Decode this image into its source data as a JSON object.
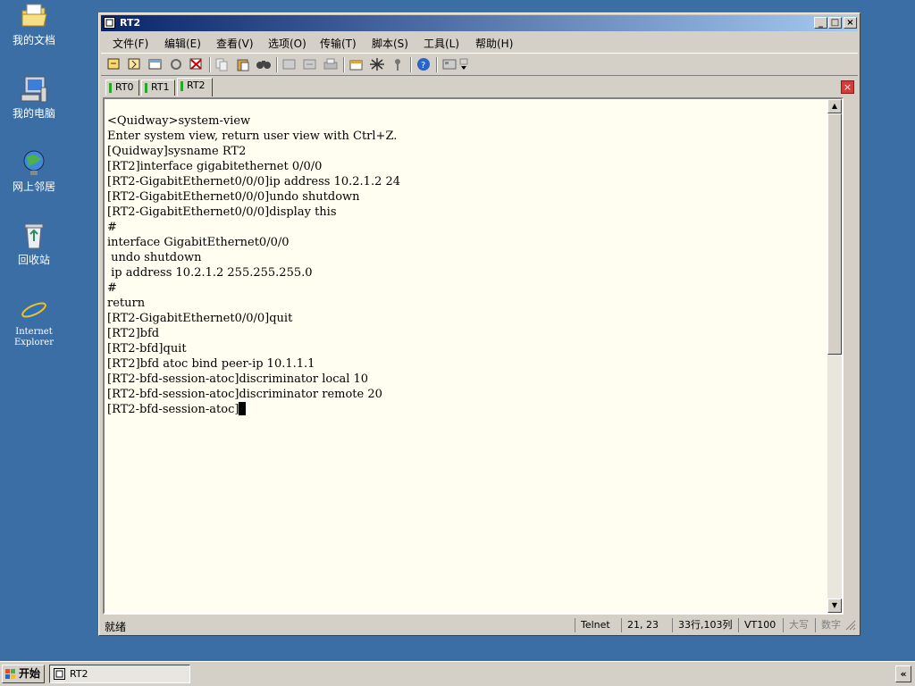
{
  "desktop": {
    "icons": [
      {
        "label": "我的文档",
        "icon": "folder-documents-icon"
      },
      {
        "label": "我的电脑",
        "icon": "computer-icon"
      },
      {
        "label": "网上邻居",
        "icon": "network-icon"
      },
      {
        "label": "回收站",
        "icon": "recycle-bin-icon"
      },
      {
        "label": "Internet Explorer",
        "label_line1": "Internet",
        "label_line2": "Explorer",
        "icon": "ie-icon"
      }
    ]
  },
  "window": {
    "title": "RT2",
    "menu": [
      "文件(F)",
      "编辑(E)",
      "查看(V)",
      "选项(O)",
      "传输(T)",
      "脚本(S)",
      "工具(L)",
      "帮助(H)"
    ],
    "tabs": [
      {
        "label": "RT0",
        "active": false
      },
      {
        "label": "RT1",
        "active": false
      },
      {
        "label": "RT2",
        "active": true
      }
    ],
    "close_tab_label": "×",
    "terminal_lines": [
      "<Quidway>system-view",
      "Enter system view, return user view with Ctrl+Z.",
      "[Quidway]sysname RT2",
      "[RT2]interface gigabitethernet 0/0/0",
      "[RT2-GigabitEthernet0/0/0]ip address 10.2.1.2 24",
      "[RT2-GigabitEthernet0/0/0]undo shutdown",
      "[RT2-GigabitEthernet0/0/0]display this",
      "#",
      "interface GigabitEthernet0/0/0",
      " undo shutdown",
      " ip address 10.2.1.2 255.255.255.0",
      "#",
      "return",
      "[RT2-GigabitEthernet0/0/0]quit",
      "[RT2]bfd",
      "[RT2-bfd]quit",
      "[RT2]bfd atoc bind peer-ip 10.1.1.1",
      "[RT2-bfd-session-atoc]discriminator local 10",
      "[RT2-bfd-session-atoc]discriminator remote 20",
      "[RT2-bfd-session-atoc]"
    ],
    "status": {
      "ready": "就绪",
      "protocol": "Telnet",
      "cursor_pos": "21,  23",
      "size": "33行,103列",
      "terminal_type": "VT100",
      "caps": "大写",
      "num": "数字"
    }
  },
  "taskbar": {
    "start_label": "开始",
    "task_label": "RT2",
    "tray_label": "«"
  },
  "colors": {
    "desktop": "#3a6ea5",
    "titlebar_start": "#0a246a",
    "titlebar_end": "#a6caf0",
    "terminal_bg": "#fffef0",
    "tab_marker": "#22aa22"
  }
}
